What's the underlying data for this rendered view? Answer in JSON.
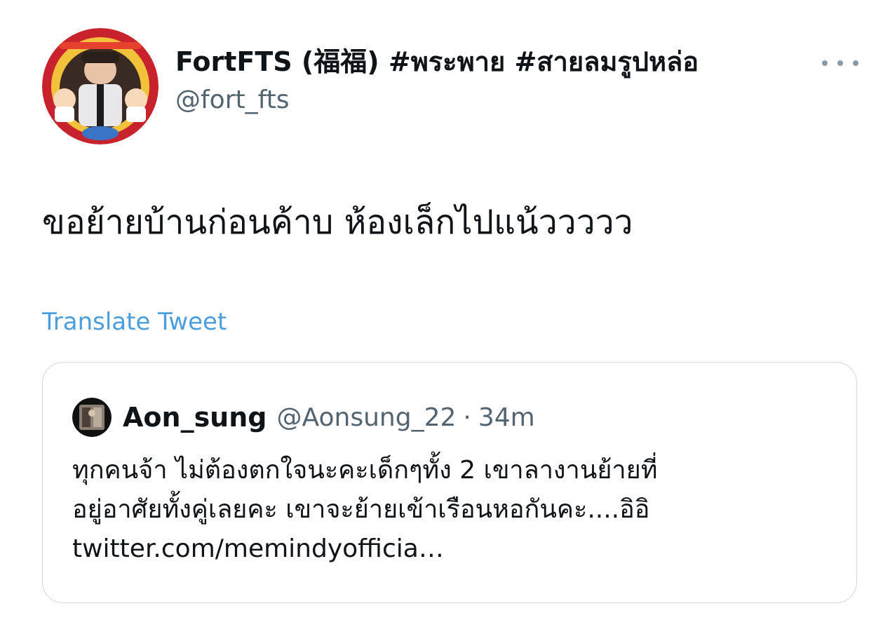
{
  "tweet": {
    "author": {
      "display_name": "FortFTS (福福) #พระพาย #สายลมรูปหล่อ",
      "handle": "@fort_fts",
      "avatar_icon": "profile-avatar"
    },
    "more_icon": "ellipsis-icon",
    "text": "ขอย้ายบ้านก่อนค้าบ ห้องเล็กไปแน้ววววว",
    "translate_label": "Translate Tweet",
    "quoted": {
      "display_name": "Aon_sung",
      "handle": "@Aonsung_22",
      "separator": "·",
      "time": "34m",
      "avatar_icon": "profile-avatar",
      "lines": [
        "ทุกคนจ้า ไม่ต้องตกใจนะคะเด็กๆทั้ง 2 เขาลางานย้ายที่",
        "อยู่อาศัยทั้งคู่เลยคะ เขาจะย้ายเข้าเรือนหอกันคะ....อิอิ",
        "twitter.com/memindyofficia…"
      ]
    }
  },
  "colors": {
    "text_primary": "#0f1419",
    "text_secondary": "#536471",
    "link": "#4a9ee0",
    "border": "#d3d9de",
    "background": "#ffffff"
  }
}
